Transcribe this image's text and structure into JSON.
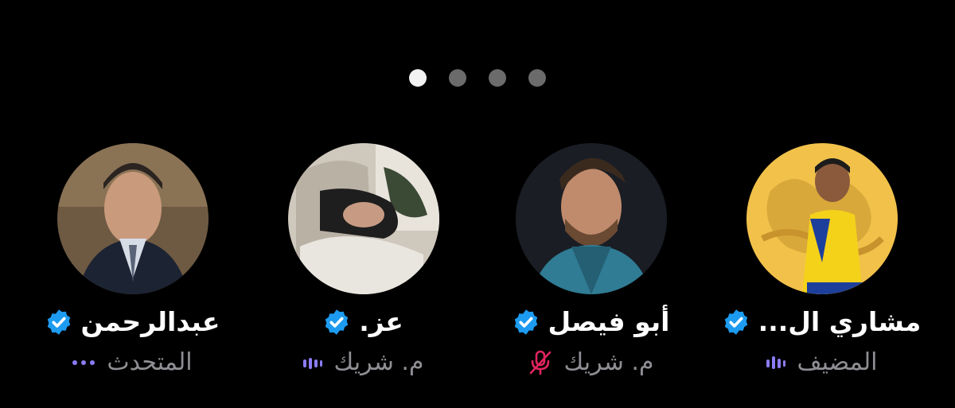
{
  "colors": {
    "background": "#000000",
    "accent_purple": "#8b7cf6",
    "muted_red": "#e0245e",
    "verified_blue": "#1d9bf0",
    "secondary_text": "#8e8e93"
  },
  "pager": {
    "page_count": 4,
    "active_index": 0
  },
  "participants": [
    {
      "name": "عبدالرحمن",
      "verified": true,
      "role": "المتحدث",
      "status_icon": "speaker-dots-icon"
    },
    {
      "name": "عز.",
      "verified": true,
      "role": "م. شريك",
      "status_icon": "audio-bars-icon"
    },
    {
      "name": "أبو فيصل",
      "verified": true,
      "role": "م. شريك",
      "status_icon": "mic-muted-icon"
    },
    {
      "name": "مشاري ال...",
      "verified": true,
      "role": "المضيف",
      "status_icon": "audio-bars-icon"
    }
  ]
}
